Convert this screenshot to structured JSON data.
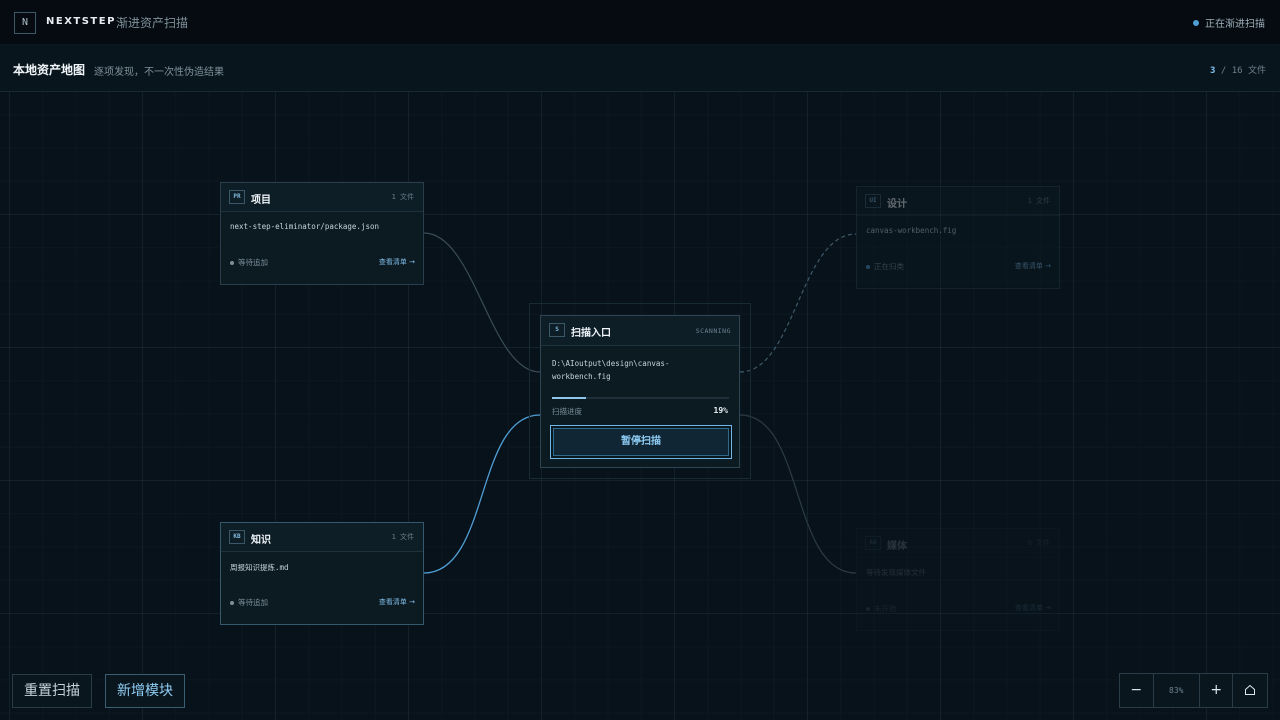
{
  "app": {
    "logo_letter": "N",
    "brand": "NEXTSTEP",
    "subtitle": "渐进资产扫描",
    "status": "正在渐进扫描"
  },
  "subheader": {
    "title": "本地资产地图",
    "description": "逐项发现，不一次性伪造结果",
    "count_current": "3",
    "count_separator": "/",
    "count_total": "16",
    "count_unit": "文件"
  },
  "nodes": {
    "project": {
      "tag": "PR",
      "title": "项目",
      "count": "1 文件",
      "path": "next-step-eliminator/package.json",
      "state": "等待追加",
      "link": "查看清单 →"
    },
    "knowledge": {
      "tag": "KB",
      "title": "知识",
      "count": "1 文件",
      "path": "周报知识提炼.md",
      "state": "等待追加",
      "link": "查看清单 →"
    },
    "design": {
      "tag": "UI",
      "title": "设计",
      "count": "1 文件",
      "path": "canvas-workbench.fig",
      "state": "正在归类",
      "link": "查看清单 →"
    },
    "media": {
      "tag": "AV",
      "title": "媒体",
      "count": "0 文件",
      "path": "等待发现媒体文件",
      "state": "未开始",
      "link": "查看清单 →"
    }
  },
  "scan": {
    "tag": "S",
    "title": "扫描入口",
    "state": "SCANNING",
    "path": "D:\\AIoutput\\design\\canvas-workbench.fig",
    "progress_label": "扫描进度",
    "progress": 19,
    "progress_text": "19%",
    "pause_label": "暂停扫描"
  },
  "controls": {
    "reset": "重置扫描",
    "add_module": "新增模块",
    "zoom_out": "−",
    "zoom_level": "83%",
    "zoom_in": "+",
    "home_icon": "home-icon"
  },
  "colors": {
    "accent": "#8fcdf5",
    "link_active": "#4f9fd6",
    "background": "#08121a"
  }
}
